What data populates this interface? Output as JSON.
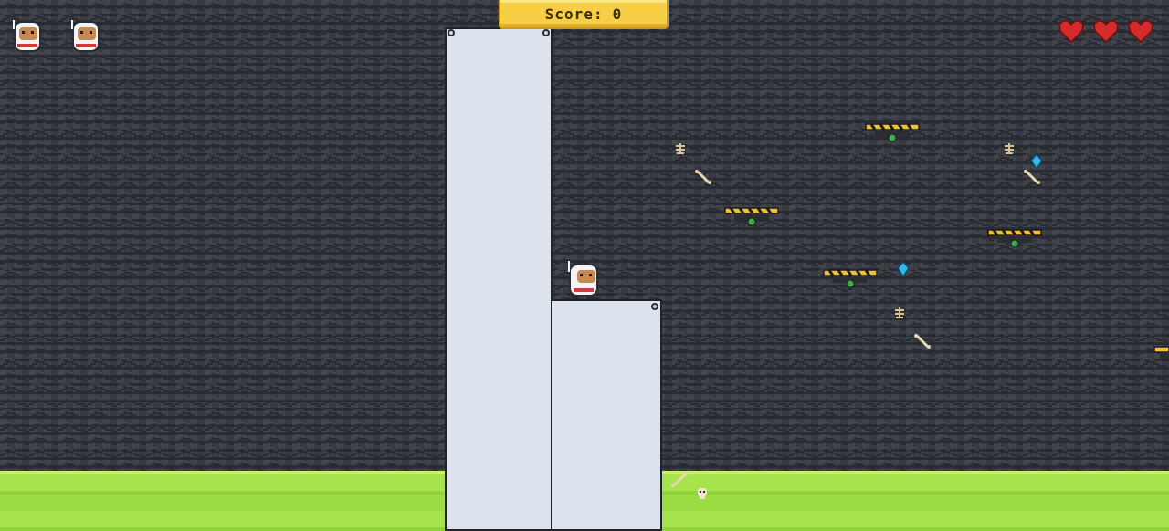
{
  "hud": {
    "score_label": "Score:",
    "score_value": "0",
    "lives": 2,
    "hearts": 3,
    "heart_color": "#d62b2b"
  },
  "colors": {
    "background": "#3a3d45",
    "ground": "#a6e34c",
    "pillar": "#dde3ec",
    "scoreboard": "#f7cf45",
    "hazard_stripe": "#f2c12e",
    "gem": "#35b6e8",
    "drone_light": "#3fae4a"
  },
  "icons": {
    "life": "astronaut-icon",
    "heart": "heart-icon",
    "player": "astronaut-icon",
    "drone": "hover-drone-icon",
    "gem": "blue-gem-icon",
    "bone": "bone-icon",
    "fossil": "fossil-icon",
    "skull": "skull-icon"
  }
}
